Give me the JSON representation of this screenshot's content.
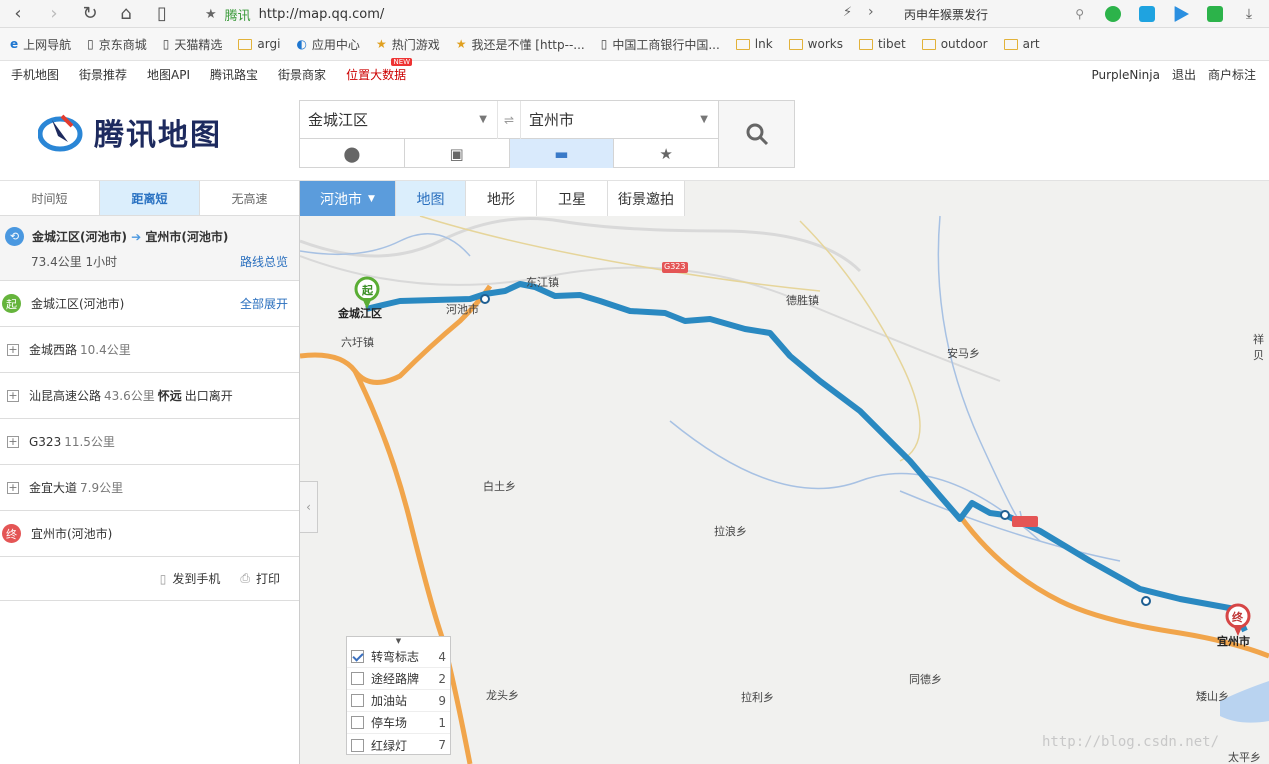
{
  "browser": {
    "site_name": "腾讯",
    "url": "http://map.qq.com/",
    "search_text": "丙申年猴票发行"
  },
  "bookmarks": [
    "上网导航",
    "京东商城",
    "天猫精选",
    "argi",
    "应用中心",
    "热门游戏",
    "我还是不懂 [http--...",
    "中国工商银行中国...",
    "lnk",
    "works",
    "tibet",
    "outdoor",
    "art"
  ],
  "site_nav": {
    "left": [
      "手机地图",
      "街景推荐",
      "地图API",
      "腾讯路宝",
      "街景商家"
    ],
    "hot": "位置大数据",
    "hot_badge": "NEW",
    "user": "PurpleNinja",
    "logout": "退出",
    "merchant": "商户标注"
  },
  "logo_text": "腾讯地图",
  "route": {
    "from": "金城江区",
    "to": "宜州市",
    "swap": "⇌"
  },
  "plan_tabs": [
    "时间短",
    "距离短",
    "无高速"
  ],
  "summary": {
    "from": "金城江区(河池市)",
    "to": "宜州市(河池市)",
    "info": "73.4公里 1小时",
    "overview": "路线总览"
  },
  "steps": {
    "start_badge": "起",
    "start": "金城江区(河池市)",
    "expand_all": "全部展开",
    "items": [
      {
        "name": "金城西路",
        "dist": "10.4公里",
        "extra": "",
        "extra_tail": ""
      },
      {
        "name": "汕昆高速公路",
        "dist": "43.6公里",
        "extra": "怀远",
        "extra_tail": "出口离开"
      },
      {
        "name": "G323",
        "dist": "11.5公里",
        "extra": "",
        "extra_tail": ""
      },
      {
        "name": "金宜大道",
        "dist": "7.9公里",
        "extra": "",
        "extra_tail": ""
      }
    ],
    "end_badge": "终",
    "end": "宜州市(河池市)"
  },
  "actions": {
    "send": "发到手机",
    "print": "打印"
  },
  "map": {
    "city": "河池市",
    "tabs": [
      "地图",
      "地形",
      "卫星",
      "街景邀拍"
    ],
    "start_marker": "起",
    "end_marker": "终",
    "road_shield": "G323",
    "labels": {
      "jinchengjiang": "金城江区",
      "hechi": "河池市",
      "dongjiang": "东江镇",
      "desheng": "德胜镇",
      "liuxu": "六圩镇",
      "anma": "安马乡",
      "xiang": "祥贝",
      "baitu": "白土乡",
      "lalang": "拉浪乡",
      "tongde": "同德乡",
      "longtou": "龙头乡",
      "lali": "拉利乡",
      "aishan": "矮山乡",
      "taiping": "太平乡",
      "yizhou": "宜州市"
    },
    "layers": [
      {
        "name": "转弯标志",
        "count": "4",
        "checked": true
      },
      {
        "name": "途经路牌",
        "count": "2",
        "checked": false
      },
      {
        "name": "加油站",
        "count": "9",
        "checked": false
      },
      {
        "name": "停车场",
        "count": "1",
        "checked": false
      },
      {
        "name": "红绿灯",
        "count": "7",
        "checked": false
      }
    ],
    "watermark": "http://blog.csdn.net/"
  }
}
